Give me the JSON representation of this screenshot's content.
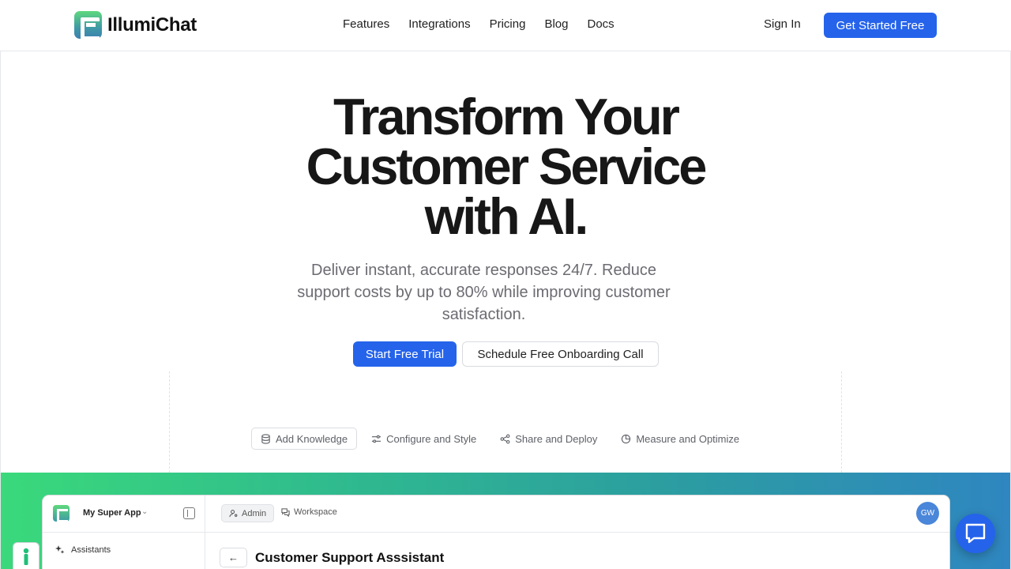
{
  "brand": {
    "name": "IllumiChat"
  },
  "nav": {
    "items": [
      "Features",
      "Integrations",
      "Pricing",
      "Blog",
      "Docs"
    ]
  },
  "header": {
    "sign_in": "Sign In",
    "cta": "Get Started Free"
  },
  "hero": {
    "title_line1": "Transform Your",
    "title_line2": "Customer Service",
    "title_line3": "with AI.",
    "subtitle": "Deliver instant, accurate responses 24/7. Reduce support costs by up to 80% while improving customer satisfaction.",
    "primary_cta": "Start Free Trial",
    "secondary_cta": "Schedule Free Onboarding Call"
  },
  "steps": [
    {
      "label": "Add Knowledge",
      "icon": "database-icon",
      "active": true
    },
    {
      "label": "Configure and Style",
      "icon": "sliders-icon",
      "active": false
    },
    {
      "label": "Share and Deploy",
      "icon": "share-icon",
      "active": false
    },
    {
      "label": "Measure and Optimize",
      "icon": "pie-chart-icon",
      "active": false
    }
  ],
  "preview": {
    "app_name": "My Super App",
    "sidebar_item": "Assistants",
    "admin": "Admin",
    "workspace": "Workspace",
    "avatar": "GW",
    "page_title": "Customer Support Asssistant"
  },
  "colors": {
    "accent": "#2563eb",
    "gradient_start": "#3ad97b",
    "gradient_end": "#2f86c0"
  }
}
